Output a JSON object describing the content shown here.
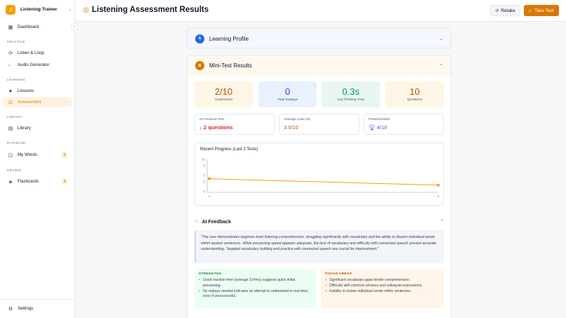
{
  "app": {
    "name": "Listening Trainer"
  },
  "sidebar": {
    "dashboard": "Dashboard",
    "sections": {
      "practice": "PRACTICE",
      "learning": "LEARNING",
      "library": "LIBRARY",
      "database": "DATABASE",
      "review": "REVIEW"
    },
    "listen_loop": "Listen & Loop",
    "audio_generator": "Audio Generator",
    "lessons": "Lessons",
    "assessment": "Assessment",
    "library": "Library",
    "my_words": "My Words",
    "my_words_badge": "0",
    "flashcards": "Flashcards",
    "flashcards_badge": "0",
    "settings": "Settings"
  },
  "header": {
    "title": "Listening Assessment Results",
    "retake": "Retake",
    "take_test": "Take Test"
  },
  "sections": {
    "profile": {
      "letter": "A",
      "title": "Learning Profile"
    },
    "mini_test": {
      "letter": "B",
      "title": "Mini-Test Results"
    }
  },
  "stats": [
    {
      "value": "2/10",
      "label": "Understood"
    },
    {
      "value": "0",
      "label": "Total Replays"
    },
    {
      "value": "0.3s",
      "label": "Avg Thinking Time"
    },
    {
      "value": "10",
      "label": "Questions"
    }
  ],
  "comparisons": {
    "previous": {
      "label": "vs Previous Test",
      "arrow": "↓",
      "value": "2 questions"
    },
    "average": {
      "label": "Average (Last 10)",
      "value": "3.0/10"
    },
    "best": {
      "label": "Personal Best",
      "value": "4/10"
    }
  },
  "chart_data": {
    "type": "line",
    "title": "Recent Progress (Last 2 Tests)",
    "x": [
      1,
      2
    ],
    "x_tick_labels": [
      "1",
      "2"
    ],
    "y": [
      4,
      2
    ],
    "ylim": [
      0,
      10
    ],
    "y_ticks": [
      0,
      3,
      5,
      8,
      10
    ],
    "grid": false,
    "line_color": "#f59e0b"
  },
  "ai_feedback": {
    "title": "AI Feedback",
    "summary": "\"The user demonstrates beginner-level listening comprehension, struggling significantly with vocabulary and the ability to discern individual words within spoken sentences. While processing speed appears adequate, the lack of vocabulary and difficulty with connected speech prevent accurate understanding. Targeted vocabulary building and practice with connected speech are crucial for improvement.\"",
    "strengths_title": "STRENGTHS",
    "strengths": [
      "Good reaction time (average 314ms) suggests quick initial processing.",
      "No replays needed indicates an attempt to understand in real-time, even if unsuccessful."
    ],
    "focus_title": "FOCUS AREAS",
    "focus": [
      "Significant vocabulary gaps hinder comprehension.",
      "Difficulty with common phrases and colloquial expressions.",
      "Inability to isolate individual words within sentences."
    ]
  },
  "colors": {
    "accent": "#d97706",
    "profile_letter": "#2563eb",
    "test_letter": "#d97706",
    "danger": "#dc2626"
  }
}
